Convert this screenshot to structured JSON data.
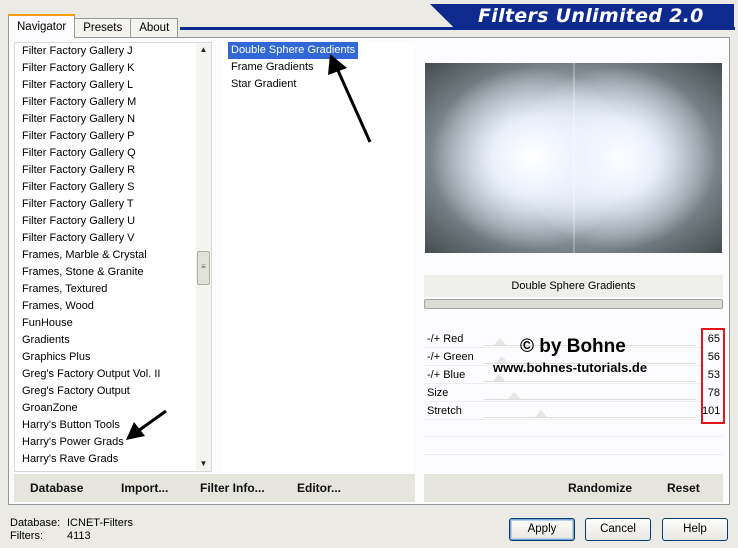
{
  "tabs": [
    "Navigator",
    "Presets",
    "About"
  ],
  "title": "Filters Unlimited 2.0",
  "categories": [
    "Filter Factory Gallery J",
    "Filter Factory Gallery K",
    "Filter Factory Gallery L",
    "Filter Factory Gallery M",
    "Filter Factory Gallery N",
    "Filter Factory Gallery P",
    "Filter Factory Gallery Q",
    "Filter Factory Gallery R",
    "Filter Factory Gallery S",
    "Filter Factory Gallery T",
    "Filter Factory Gallery U",
    "Filter Factory Gallery V",
    "Frames, Marble & Crystal",
    "Frames, Stone & Granite",
    "Frames, Textured",
    "Frames, Wood",
    "FunHouse",
    "Gradients",
    "Graphics Plus",
    "Greg's Factory Output Vol. II",
    "Greg's Factory Output",
    "GroanZone",
    "Harry's Button Tools",
    "Harry's Power Grads",
    "Harry's Rave Grads"
  ],
  "filters": [
    "Double Sphere Gradients",
    "Frame Gradients",
    "Star Gradient"
  ],
  "selected_filter": "Double Sphere Gradients",
  "params": [
    {
      "label": "-/+ Red",
      "value": "65"
    },
    {
      "label": "-/+ Green",
      "value": "56"
    },
    {
      "label": "-/+ Blue",
      "value": "53"
    },
    {
      "label": "Size",
      "value": "78"
    },
    {
      "label": "Stretch",
      "value": "101"
    }
  ],
  "watermark": {
    "line1": "© by Bohne",
    "line2": "www.bohnes-tutorials.de"
  },
  "toolbar": {
    "database": "Database",
    "import": "Import...",
    "filter_info": "Filter Info...",
    "editor": "Editor...",
    "randomize": "Randomize",
    "reset": "Reset"
  },
  "status": {
    "database_key": "Database:",
    "database_val": "ICNET-Filters",
    "filters_key": "Filters:",
    "filters_val": "4113"
  },
  "buttons": {
    "apply": "Apply",
    "cancel": "Cancel",
    "help": "Help"
  },
  "colors": {
    "banner": "#0f2a8f",
    "selection": "#3168d5",
    "highlight": "#e0161b"
  }
}
